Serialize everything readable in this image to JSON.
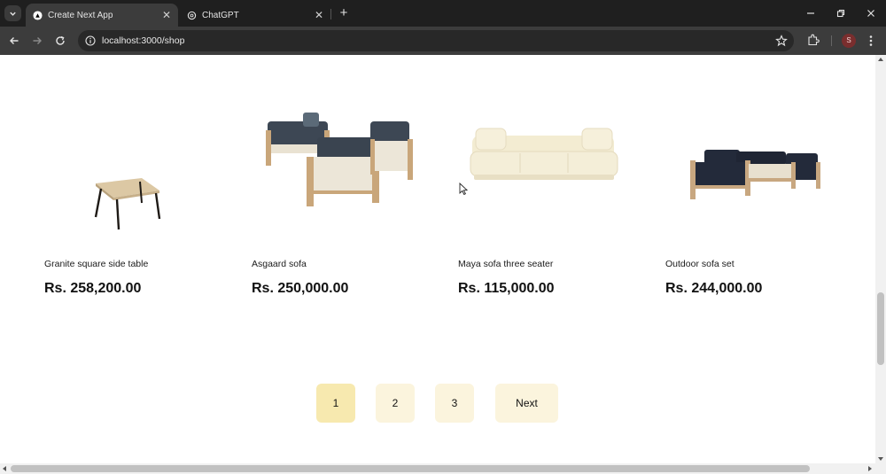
{
  "browser": {
    "tabs": [
      {
        "title": "Create Next App",
        "active": true,
        "favicon": "nextjs-icon"
      },
      {
        "title": "ChatGPT",
        "active": false,
        "favicon": "openai-icon"
      }
    ],
    "url": "localhost:3000/shop",
    "profile_initial": "S"
  },
  "products": [
    {
      "name": "Granite square side table",
      "price": "Rs. 258,200.00",
      "image": "square-side-table"
    },
    {
      "name": "Asgaard sofa",
      "price": "Rs. 250,000.00",
      "image": "asgaard-sofa-set"
    },
    {
      "name": "Maya sofa three seater",
      "price": "Rs. 115,000.00",
      "image": "three-seater-sofa"
    },
    {
      "name": "Outdoor sofa set",
      "price": "Rs. 244,000.00",
      "image": "outdoor-sofa-set"
    }
  ],
  "pagination": {
    "pages": [
      "1",
      "2",
      "3"
    ],
    "current": "1",
    "next_label": "Next"
  },
  "colors": {
    "pager_active": "#f7e9af",
    "pager_inactive": "#fbf4dd",
    "chrome_dark": "#1f1f1f",
    "chrome_toolbar": "#3c3c3c"
  }
}
